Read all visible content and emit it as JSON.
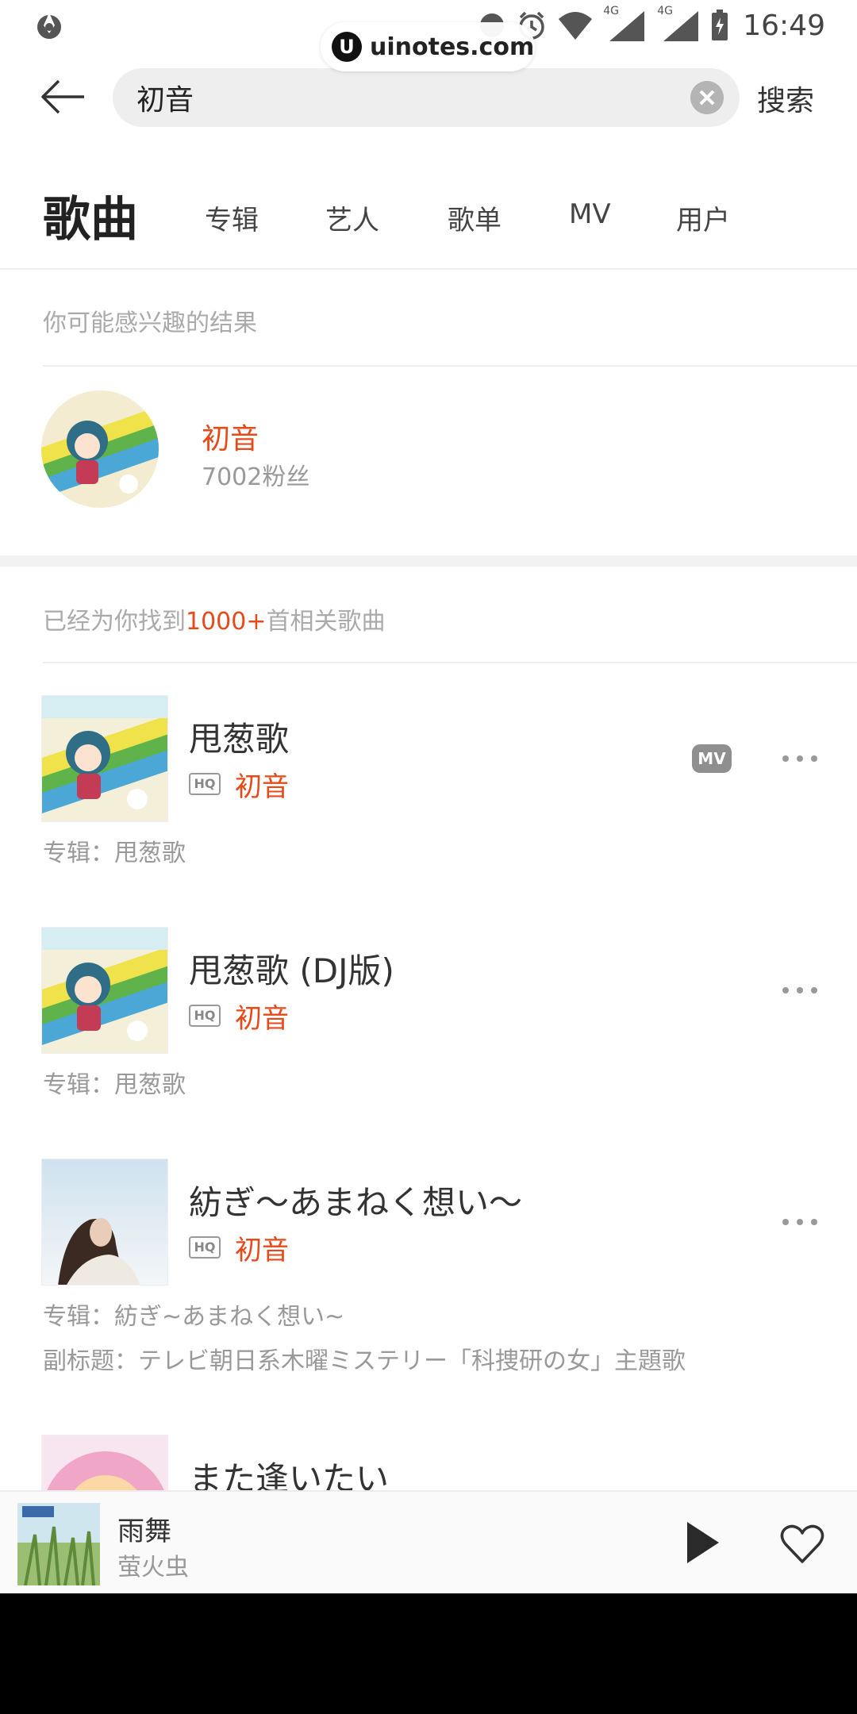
{
  "status_bar": {
    "time": "16:49",
    "net1": "4G",
    "net2": "4G"
  },
  "watermark": {
    "logo": "U",
    "text": "uinotes.com"
  },
  "search": {
    "query": "初音",
    "placeholder": "",
    "submit_label": "搜索"
  },
  "tabs": [
    {
      "label": "歌曲"
    },
    {
      "label": "专辑"
    },
    {
      "label": "艺人"
    },
    {
      "label": "歌单"
    },
    {
      "label": "MV"
    },
    {
      "label": "用户"
    }
  ],
  "interest": {
    "heading": "你可能感兴趣的结果",
    "artist_name": "初音",
    "fans": "7002粉丝"
  },
  "results_summary": {
    "prefix": "已经为你找到",
    "count": "1000+",
    "suffix": "首相关歌曲"
  },
  "songs": [
    {
      "title": "甩葱歌",
      "quality": "HQ",
      "artist": "初音",
      "mv_label": "MV",
      "album": "专辑：甩葱歌"
    },
    {
      "title": "甩葱歌 (DJ版)",
      "quality": "HQ",
      "artist": "初音",
      "album": "专辑：甩葱歌"
    },
    {
      "title": "紡ぎ～あまねく想い～",
      "quality": "HQ",
      "artist": "初音",
      "album": "专辑：紡ぎ~あまねく想い~",
      "subtitle": "副标题：テレビ朝日系木曜ミステリー「科捜研の女」主題歌"
    },
    {
      "title": "また逢いたい"
    }
  ],
  "now_playing": {
    "title": "雨舞",
    "artist": "萤火虫"
  },
  "colors": {
    "accent": "#e64a19",
    "muted": "#999999",
    "divider": "#efefef"
  }
}
